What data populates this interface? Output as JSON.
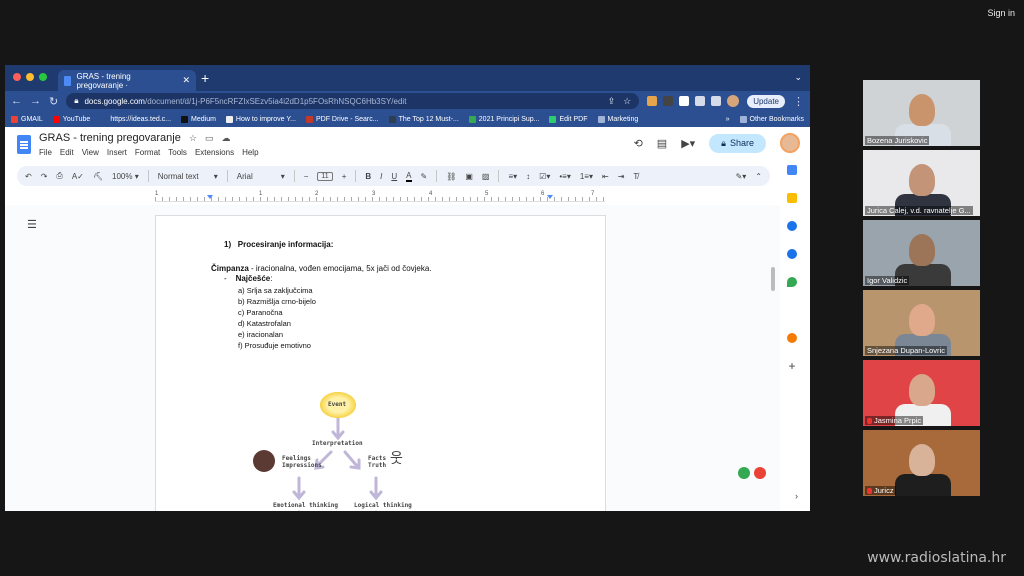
{
  "overlay": {
    "sign_in": "Sign in",
    "watermark": "www.radioslatina.hr"
  },
  "browser": {
    "tab_title": "GRAS - trening pregovaranje ·",
    "url_host": "docs.google.com",
    "url_path": "/document/d/1j-P6F5ncRFZIxSEzv5ia4i2dD1p5FOsRhNSQC6Hb3SY/edit",
    "update_label": "Update",
    "bookmarks": [
      {
        "label": "GMAIL",
        "icon": "gmail-icon"
      },
      {
        "label": "YouTube",
        "icon": "youtube-icon"
      },
      {
        "label": "https://ideas.ted.c...",
        "icon": "link-icon"
      },
      {
        "label": "Medium",
        "icon": "medium-icon"
      },
      {
        "label": "How to improve Y...",
        "icon": "globe-icon"
      },
      {
        "label": "PDF Drive - Searc...",
        "icon": "pdf-icon"
      },
      {
        "label": "The Top 12 Must-...",
        "icon": "page-icon"
      },
      {
        "label": "2021 Principi Sup...",
        "icon": "drive-icon"
      },
      {
        "label": "Edit PDF",
        "icon": "edit-pdf-icon"
      },
      {
        "label": "Marketing",
        "icon": "folder-icon"
      }
    ],
    "bookmarks_more": "»",
    "other_bookmarks": "Other Bookmarks"
  },
  "docs": {
    "title": "GRAS - trening pregovaranje",
    "menu": [
      "File",
      "Edit",
      "View",
      "Insert",
      "Format",
      "Tools",
      "Extensions",
      "Help"
    ],
    "share_label": "Share",
    "toolbar": {
      "zoom": "100%",
      "style": "Normal text",
      "font": "Arial",
      "font_size": "11"
    },
    "ruler_numbers": [
      "1",
      "1",
      "2",
      "3",
      "4",
      "5",
      "6",
      "7"
    ]
  },
  "document": {
    "heading_number": "1)",
    "heading": "Procesiranje informacija:",
    "line_bold": "Čimpanza",
    "line_rest": " - iracionalna, vođen emocijama, 5x jači od čovjeka.",
    "sub_bullet": "-",
    "sub_bold": "Najčešće",
    "sub_rest": ":",
    "items": [
      "a) Srlja sa zaključcima",
      "b) Razmišlja crno-bijelo",
      "c) Paranočna",
      "d) Katastrofalan",
      "e) iracionalan",
      "f) Prosuđuje emotivno"
    ],
    "diagram": {
      "event": "Event",
      "interpretation": "Interpretation",
      "feelings": "Feelings",
      "impressions": "Impressions",
      "facts": "Facts",
      "truth": "Truth",
      "emotional": "Emotional thinking",
      "logical": "Logical thinking"
    }
  },
  "participants": [
    {
      "name": "Bozena Juriskovic",
      "muted": false,
      "bg": "#cfd3d6",
      "skin": "#c9946c",
      "shirt": "#d9dfe6"
    },
    {
      "name": "Jurica Calej, v.d. ravnatelje G...",
      "muted": false,
      "bg": "#e9e9ec",
      "skin": "#c39478",
      "shirt": "#2f3440"
    },
    {
      "name": "Igor Validzic",
      "muted": false,
      "bg": "#9aa4ad",
      "skin": "#9c7458",
      "shirt": "#3a3a3a"
    },
    {
      "name": "Snjezana Dupan-Lovric",
      "muted": false,
      "bg": "#b9956e",
      "skin": "#e0a98c",
      "shirt": "#7b8794"
    },
    {
      "name": "Jasmina Prpic",
      "muted": true,
      "bg": "#e04446",
      "skin": "#d9a88c",
      "shirt": "#f0f0f0"
    },
    {
      "name": "Juricz",
      "muted": true,
      "bg": "#a86a3a",
      "skin": "#d8b39a",
      "shirt": "#1e1e1e"
    }
  ]
}
